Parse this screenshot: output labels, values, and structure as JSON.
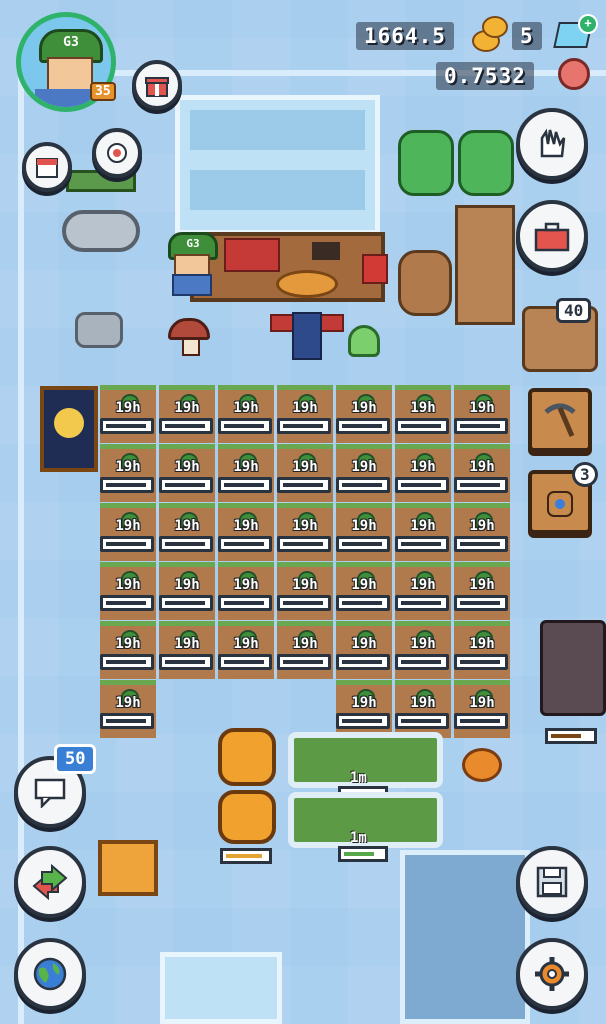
{
  "hud": {
    "coins": "1664.5",
    "gems": "5",
    "token": "0.7532",
    "player_level": "35",
    "avatar_cap_text": "G3",
    "colors": {
      "coin": "#f2b233",
      "gem": "#7fd3f2",
      "flower": "#e8746e"
    }
  },
  "left_buttons": {
    "chat_unread": "50"
  },
  "right_buttons": {
    "materials_count": "40",
    "seed_bag_count": "3"
  },
  "npc": {
    "cap_text": "G3"
  },
  "plots": {
    "timer": "19h",
    "rows": [
      7,
      7,
      7,
      7,
      7,
      4
    ]
  },
  "flower_beds": [
    {
      "timer": "1m"
    },
    {
      "timer": "1m"
    }
  ],
  "icons": {
    "gift": "gift-icon",
    "calendar": "calendar-icon",
    "camera": "camera-icon",
    "glove": "glove-icon",
    "toolbox": "toolbox-icon",
    "pickaxe": "pickaxe-icon",
    "chat": "chat-icon",
    "swap": "swap-arrows-icon",
    "world": "globe-icon",
    "save": "floppy-disk-icon",
    "settings": "gear-icon"
  }
}
